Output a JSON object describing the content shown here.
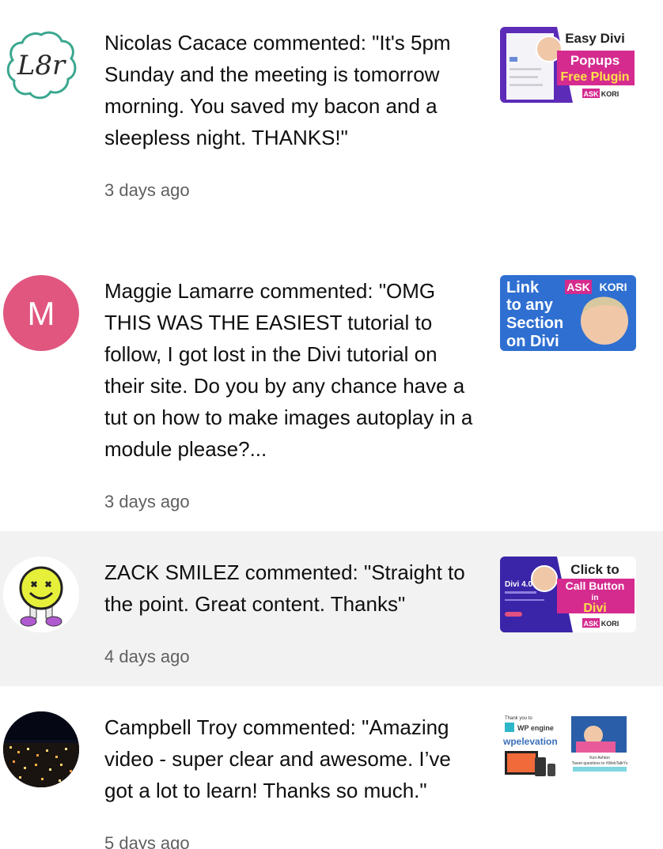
{
  "notifications": [
    {
      "avatar_icon": "l8r-logo-avatar-icon",
      "text": "Nicolas Cacace commented: \"It's 5pm Sunday and the meeting is tomorrow morning. You saved my bacon and a sleepless night. THANKS!\"",
      "time": "3 days ago",
      "avatar_text": "L8r",
      "thumbnail": {
        "line1": "Easy Divi",
        "line2": "Popups",
        "line3": "Free Plugin",
        "brand_ask": "ASK",
        "brand_kori": "KORI"
      }
    },
    {
      "avatar_icon": "letter-avatar-icon",
      "avatar_letter": "M",
      "avatar_color": "#e0567f",
      "text": "Maggie Lamarre commented: \"OMG THIS WAS THE EASIEST tutorial to follow, I got lost in the Divi tutorial on their site. Do you by any chance have a tut on how to make images autoplay in a module please?...",
      "time": "3 days ago",
      "thumbnail": {
        "line1": "Link",
        "line2": "to any",
        "line3": "Section",
        "line4": "on Divi",
        "brand_ask": "ASK",
        "brand_kori": "KORI"
      }
    },
    {
      "avatar_icon": "smiley-face-avatar-icon",
      "text": "ZACK SMILEZ commented: \"Straight to the point. Great content. Thanks\"",
      "time": "4 days ago",
      "thumbnail": {
        "line1": "Click to",
        "line2": "Call Button",
        "line3": "in",
        "line4": "Divi",
        "side_title": "Divi 4.0",
        "brand_ask": "ASK",
        "brand_kori": "KORI"
      }
    },
    {
      "avatar_icon": "city-night-avatar-icon",
      "text": "Campbell Troy commented: \"Amazing video - super clear and awesome. I’ve got a lot to learn! Thanks so much.\"",
      "time": "5 days ago",
      "thumbnail": {
        "thanks": "Thank you to",
        "wpengine": "WP engine",
        "wpelevation": "wpelevation",
        "presenter": "Kori Ashton",
        "caption": "Tweet questions to #WebTalkYs"
      }
    }
  ],
  "colors": {
    "text": "#0f0f0f",
    "time": "#606060",
    "highlight": "#f2f2f2",
    "magenta": "#d52b8f",
    "blue": "#2f6fd1",
    "purple": "#5c2bb8"
  }
}
